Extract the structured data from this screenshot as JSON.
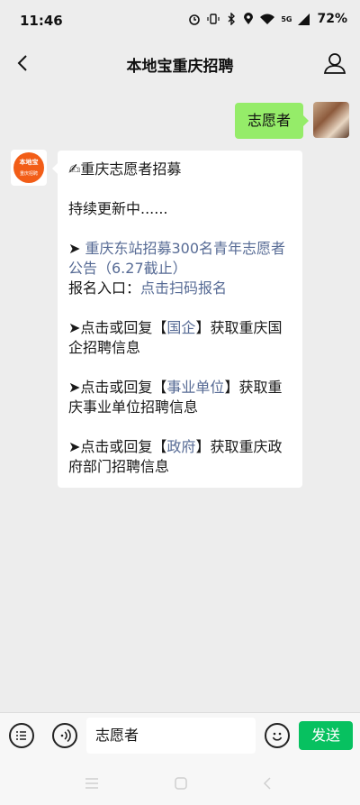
{
  "status_bar": {
    "time": "11:46",
    "battery": "72%",
    "network": "5G"
  },
  "header": {
    "title": "本地宝重庆招聘"
  },
  "messages": {
    "outgoing": {
      "text": "志愿者"
    },
    "incoming": {
      "bot_logo_text": "本地宝",
      "bot_logo_sub": "重庆招聘",
      "line_title": "✍重庆志愿者招募",
      "line_updating": "持续更新中......",
      "arrow": "➤",
      "item1_link": "重庆东站招募300名青年志愿者公告（6.27截止）",
      "item1_entry_label": "报名入口：",
      "item1_entry_link": "点击扫码报名",
      "item2_prefix": "点击或回复【",
      "item2_link": "国企",
      "item2_suffix": "】获取重庆国企招聘信息",
      "item3_prefix": "点击或回复【",
      "item3_link": "事业单位",
      "item3_suffix": "】获取重庆事业单位招聘信息",
      "item4_prefix": "点击或回复【",
      "item4_link": "政府",
      "item4_suffix": "】获取重庆政府部门招聘信息"
    }
  },
  "input_bar": {
    "value": "志愿者",
    "send_label": "发送"
  },
  "colors": {
    "accent": "#07c160",
    "bubble_out": "#95ec69",
    "link": "#576b95"
  }
}
